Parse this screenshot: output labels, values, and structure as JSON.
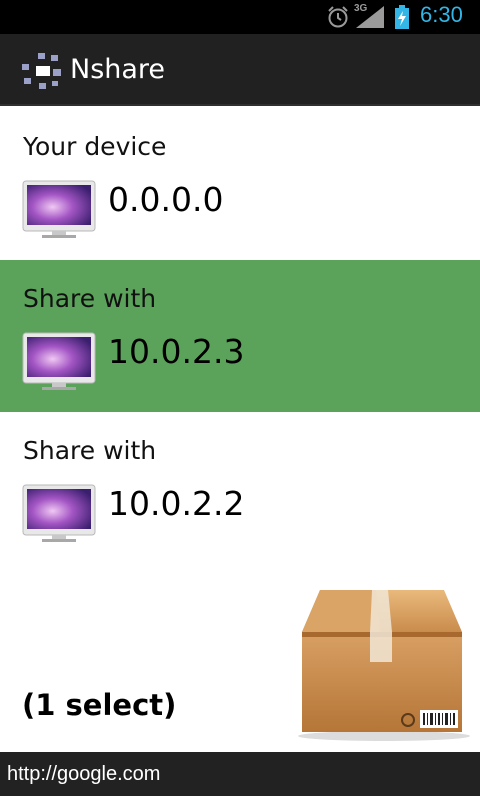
{
  "status_bar": {
    "network_type": "3G",
    "time": "6:30",
    "icons": [
      "alarm-icon",
      "signal-icon",
      "battery-charging-icon"
    ],
    "accent_color": "#33b5e5"
  },
  "action_bar": {
    "title": "Nshare",
    "logo_icon": "nshare-logo-icon"
  },
  "devices": [
    {
      "label": "Your device",
      "ip": "0.0.0.0",
      "selected": false,
      "icon": "monitor-icon"
    },
    {
      "label": "Share with",
      "ip": "10.0.2.3",
      "selected": true,
      "icon": "monitor-icon"
    },
    {
      "label": "Share with",
      "ip": "10.0.2.2",
      "selected": false,
      "icon": "monitor-icon"
    }
  ],
  "selection": {
    "count_text": "(1 select)",
    "highlight_color": "#5ba35b"
  },
  "send_box": {
    "icon": "cardboard-box-icon"
  },
  "footer": {
    "url": "http://google.com"
  }
}
